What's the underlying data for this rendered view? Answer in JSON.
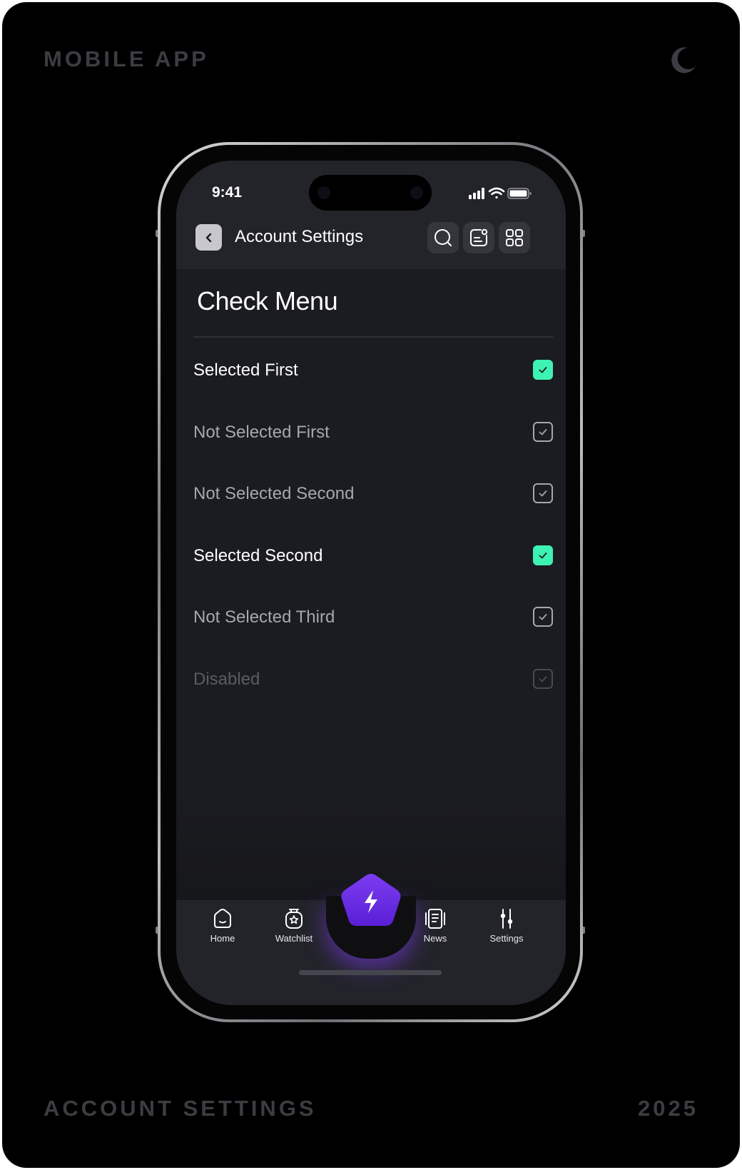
{
  "frame": {
    "top_left_label": "MOBILE APP",
    "bottom_left_label": "ACCOUNT SETTINGS",
    "bottom_right_label": "2025",
    "theme_icon": "moon-icon"
  },
  "status_bar": {
    "time": "9:41",
    "icons": [
      "cellular-signal-icon",
      "wifi-icon",
      "battery-icon"
    ]
  },
  "header": {
    "back_icon": "chevron-left-icon",
    "title": "Account Settings",
    "actions": [
      "search-icon",
      "notification-icon",
      "grid-icon"
    ]
  },
  "page": {
    "heading": "Check Menu"
  },
  "check_menu": {
    "items": [
      {
        "label": "Selected First",
        "state": "selected"
      },
      {
        "label": "Not Selected First",
        "state": "unselected"
      },
      {
        "label": "Not Selected Second",
        "state": "unselected"
      },
      {
        "label": "Selected Second",
        "state": "selected"
      },
      {
        "label": "Not Selected Third",
        "state": "unselected"
      },
      {
        "label": "Disabled",
        "state": "disabled"
      }
    ]
  },
  "tab_bar": {
    "tabs": [
      {
        "label": "Home",
        "icon": "home-icon"
      },
      {
        "label": "Watchlist",
        "icon": "watchlist-icon"
      },
      {
        "label": "News",
        "icon": "news-icon"
      },
      {
        "label": "Settings",
        "icon": "settings-sliders-icon"
      }
    ],
    "center_action_icon": "lightning-icon"
  },
  "colors": {
    "accent_check": "#3df2b3",
    "accent_action": "#7c3aed",
    "screen_background": "#1b1c21",
    "header_background": "#23242a"
  }
}
